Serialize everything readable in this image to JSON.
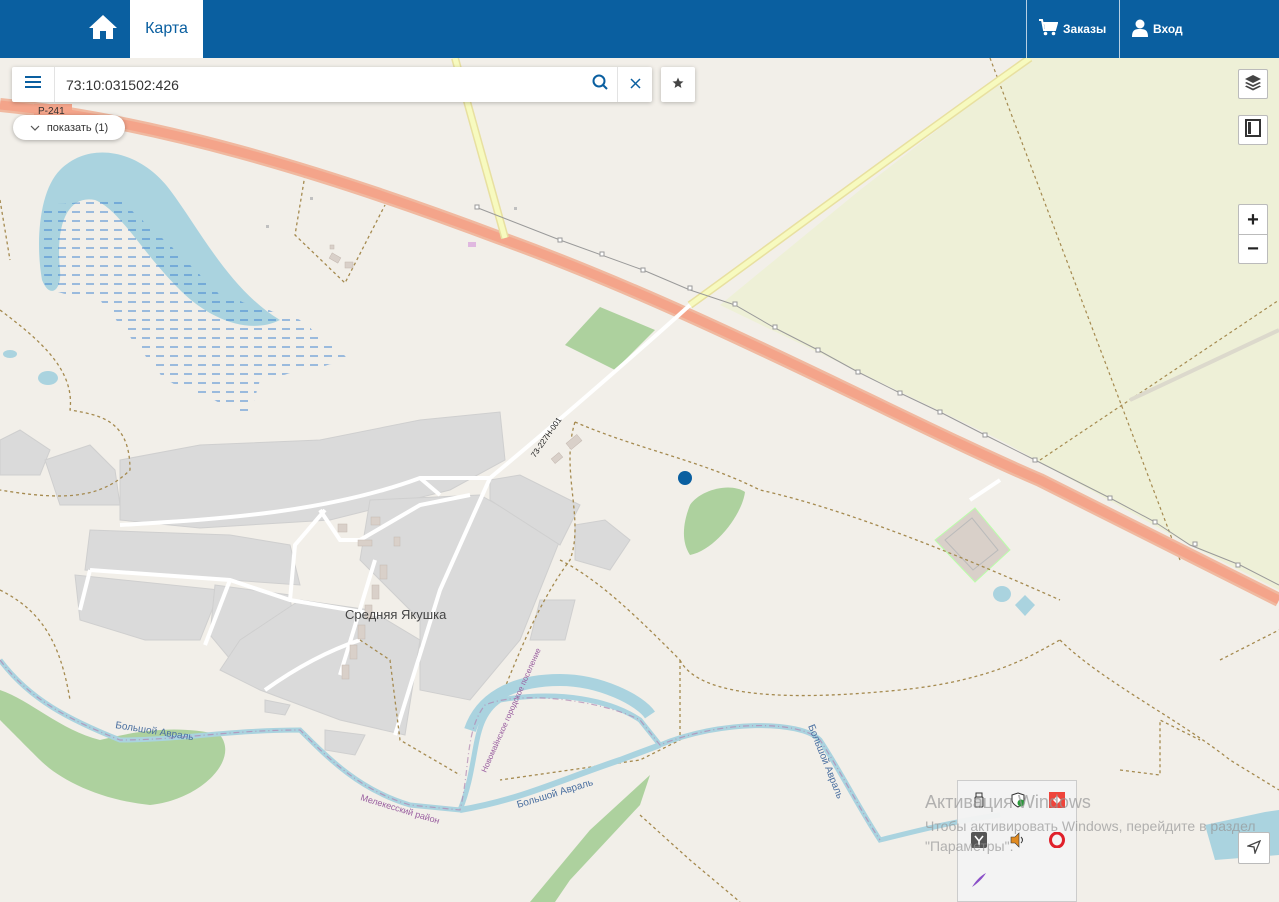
{
  "header": {
    "home_icon": "home-icon",
    "tab_map": "Карта",
    "orders_label": "Заказы",
    "login_label": "Вход",
    "brand_color": "#0a5fa0"
  },
  "search": {
    "value": "73:10:031502:426",
    "placeholder": ""
  },
  "show_button": {
    "label": "показать (1)"
  },
  "map": {
    "labels": {
      "road_p241": "Р-241",
      "road_73": "73-227Н-001",
      "village": "Средняя Якушка",
      "river_1": "Большой Авраль",
      "river_2": "Большой Авраль",
      "river_3": "Большой Авраль",
      "district": "Мелекесский район",
      "settlement": "Новомайнское городское поселение"
    }
  },
  "controls": {
    "zoom_in": "+",
    "zoom_out": "−"
  },
  "watermark": {
    "title": "Активация Windows",
    "text": "Чтобы активировать Windows, перейдите в раздел \"Параметры\"."
  }
}
